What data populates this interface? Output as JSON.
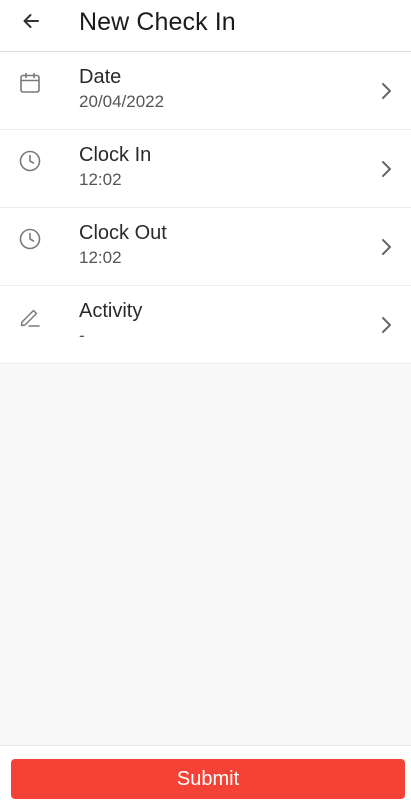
{
  "header": {
    "back_icon": "arrow-left-icon",
    "title": "New Check In"
  },
  "rows": [
    {
      "icon": "calendar-icon",
      "label": "Date",
      "value": "20/04/2022"
    },
    {
      "icon": "clock-icon",
      "label": "Clock In",
      "value": "12:02"
    },
    {
      "icon": "clock-icon",
      "label": "Clock Out",
      "value": "12:02"
    },
    {
      "icon": "pencil-icon",
      "label": "Activity",
      "value": "-"
    }
  ],
  "footer": {
    "submit_label": "Submit"
  },
  "colors": {
    "accent": "#f44336",
    "icon": "#7a7a7a",
    "background": "#f8f8f8"
  }
}
